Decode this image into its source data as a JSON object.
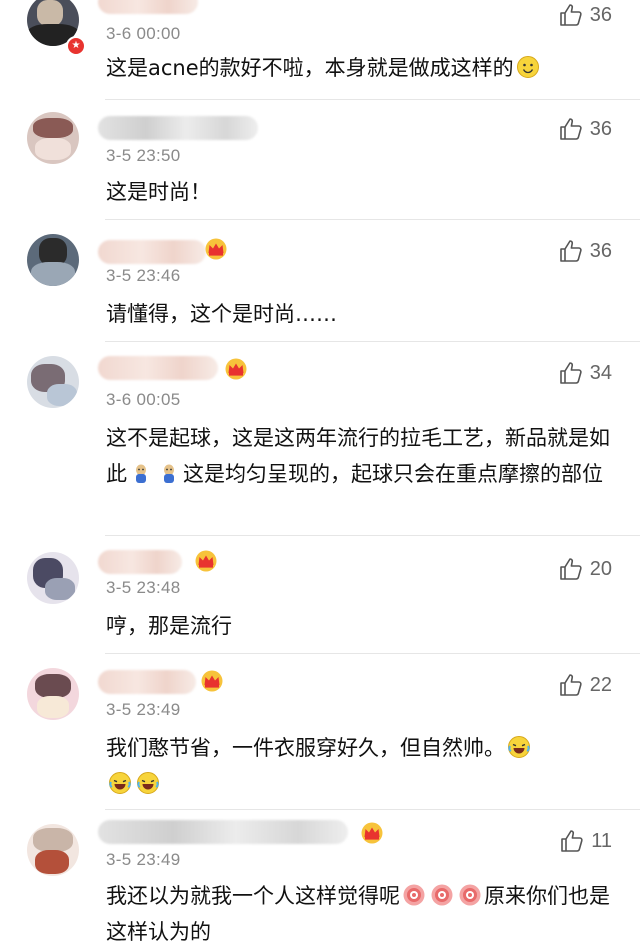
{
  "icons": {
    "like": "thumbs-up-icon",
    "crown": "crown-badge-icon",
    "verified": "verified-badge-icon"
  },
  "comments": [
    {
      "time": "3-6 00:00",
      "text": "这是acne的款好不啦，本身就是做成这样的",
      "emoji_after": "smile",
      "likes": "36"
    },
    {
      "time": "3-5 23:50",
      "text": "这是时尚！",
      "likes": "36"
    },
    {
      "time": "3-5 23:46",
      "text": "请懂得，这个是时尚……",
      "likes": "36"
    },
    {
      "time": "3-6 00:05",
      "text_part1": "这不是起球，这是这两年流行的拉毛工艺，新品就是如此",
      "text_part2": "这是均匀呈现的，起球只会在重点摩擦的部位",
      "likes": "34"
    },
    {
      "time": "3-5 23:48",
      "text": "哼，那是流行",
      "likes": "20"
    },
    {
      "time": "3-5 23:49",
      "text": "我们憨节省，一件衣服穿好久，但自然帅。",
      "likes": "22"
    },
    {
      "time": "3-5 23:49",
      "text_part1": "我还以为就我一个人这样觉得呢",
      "text_part2": "原来你们也是这样认为的",
      "likes": "11"
    }
  ]
}
